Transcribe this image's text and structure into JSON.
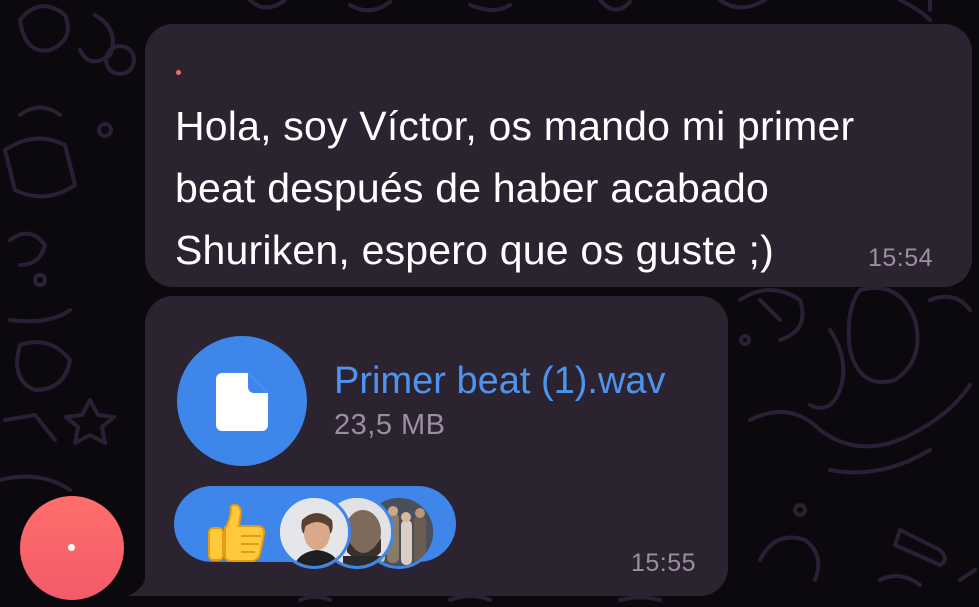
{
  "messages": [
    {
      "lines": [
        "Hola, soy Víctor, os mando mi primer",
        "beat después de haber acabado",
        "Shuriken, espero que os guste ;)"
      ],
      "time": "15:54"
    },
    {
      "file": {
        "name": "Primer beat (1).wav",
        "size": "23,5 MB",
        "icon": "document-icon"
      },
      "reaction": {
        "emoji": "👍",
        "reactor_count": 3
      },
      "time": "15:55"
    }
  ],
  "colors": {
    "bubble": "#2b2430",
    "accent": "#3e86ea",
    "file_name": "#4d93f0",
    "meta_text": "#9a8fa0",
    "avatar_gradient": "#ff6f6a"
  }
}
